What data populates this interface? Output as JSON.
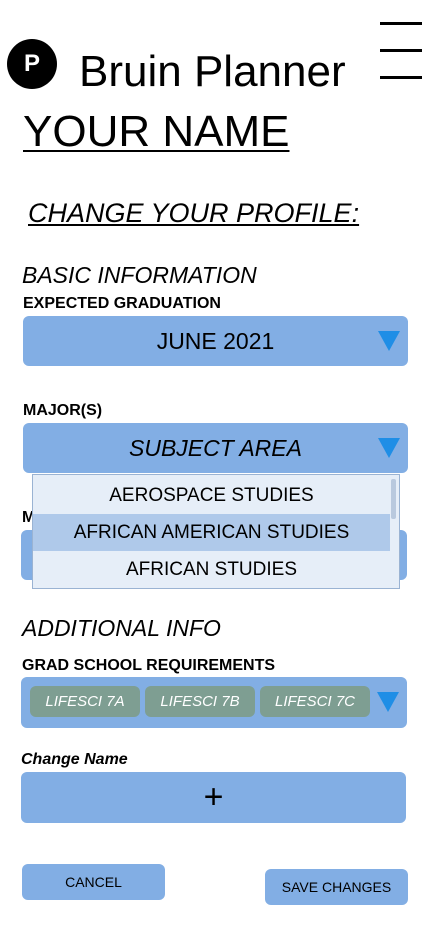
{
  "header": {
    "logo_letter": "P",
    "app_title": "Bruin Planner"
  },
  "user": {
    "name": "YOUR NAME"
  },
  "page": {
    "title": "CHANGE YOUR PROFILE:"
  },
  "basic_info": {
    "heading": "BASIC INFORMATION",
    "graduation": {
      "label": "EXPECTED GRADUATION",
      "value": "JUNE 2021"
    },
    "majors": {
      "label": "MAJOR(S)",
      "value": "SUBJECT AREA",
      "options": [
        {
          "label": "AEROSPACE STUDIES",
          "selected": false
        },
        {
          "label": "AFRICAN AMERICAN STUDIES",
          "selected": true
        },
        {
          "label": "AFRICAN STUDIES",
          "selected": false
        }
      ],
      "hidden_label_fragment": "M"
    }
  },
  "additional_info": {
    "heading": "ADDITIONAL INFO",
    "grad_school": {
      "label": "GRAD SCHOOL REQUIREMENTS",
      "chips": [
        "LIFESCI 7A",
        "LIFESCI 7B",
        "LIFESCI 7C"
      ]
    },
    "change_name": {
      "label": "Change Name",
      "add_symbol": "+"
    }
  },
  "actions": {
    "cancel": "CANCEL",
    "save": "SAVE CHANGES"
  },
  "colors": {
    "field": "#82aee4",
    "arrow": "#1f8ee6",
    "chip": "#7e9e92",
    "dropdown_bg": "#e6eef8",
    "dropdown_selected": "#afc9ea"
  }
}
